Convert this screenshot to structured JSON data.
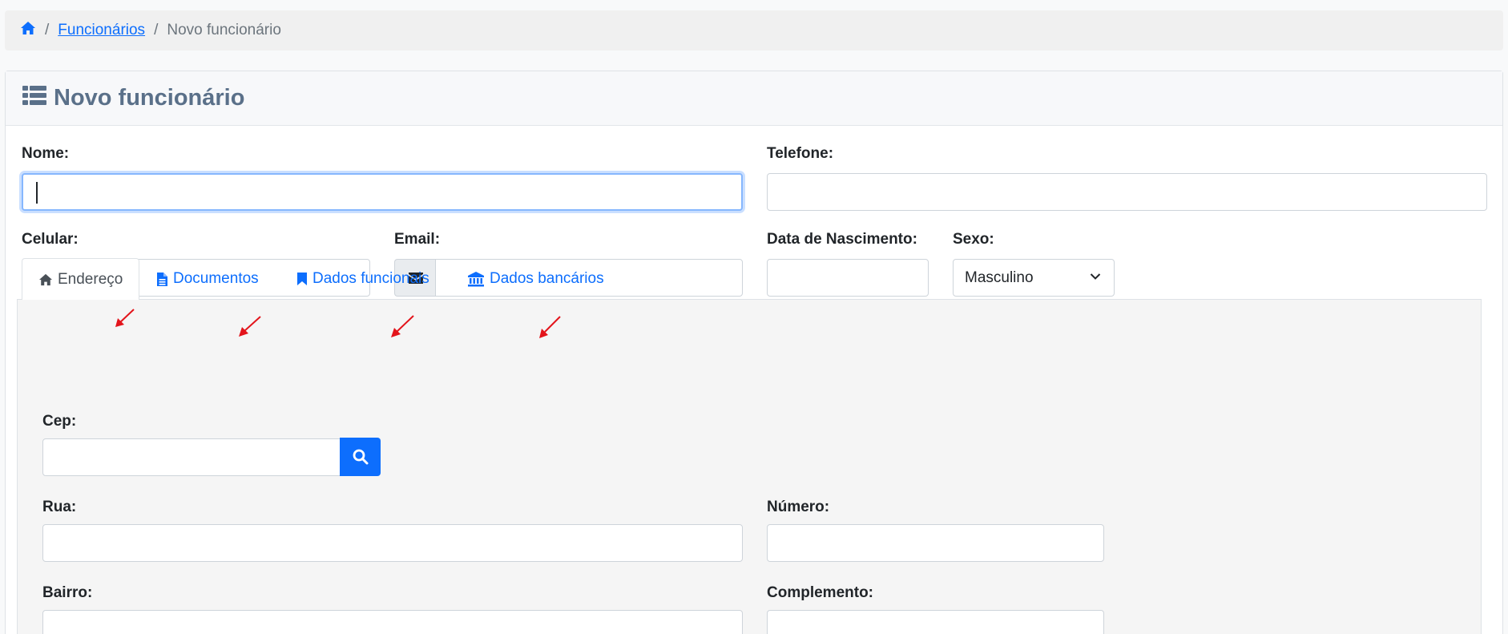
{
  "breadcrumb": {
    "home_icon": "home-icon",
    "link_label": "Funcionários",
    "current": "Novo funcionário",
    "separator": "/"
  },
  "card": {
    "title": "Novo funcionário",
    "title_icon": "list-icon"
  },
  "fields": {
    "nome": {
      "label": "Nome:",
      "value": ""
    },
    "telefone": {
      "label": "Telefone:",
      "value": ""
    },
    "celular": {
      "label": "Celular:",
      "value": ""
    },
    "email": {
      "label": "Email:",
      "value": "",
      "icon": "envelope-icon"
    },
    "data_nascimento": {
      "label": "Data de Nascimento:",
      "value": ""
    },
    "sexo": {
      "label": "Sexo:",
      "selected": "Masculino"
    }
  },
  "tabs": [
    {
      "label": "Endereço",
      "icon": "home-icon",
      "active": true
    },
    {
      "label": "Documentos",
      "icon": "file-icon",
      "active": false
    },
    {
      "label": "Dados funcionais",
      "icon": "bookmark-icon",
      "active": false
    },
    {
      "label": "Dados bancários",
      "icon": "bank-icon",
      "active": false
    }
  ],
  "address": {
    "cep": {
      "label": "Cep:",
      "value": "",
      "button_icon": "search-icon"
    },
    "rua": {
      "label": "Rua:",
      "value": ""
    },
    "numero": {
      "label": "Número:",
      "value": ""
    },
    "bairro": {
      "label": "Bairro:",
      "value": ""
    },
    "complemento": {
      "label": "Complemento:",
      "value": ""
    }
  },
  "colors": {
    "primary": "#0d6efd",
    "title": "#5a7089",
    "annotation_arrow": "#e3141b"
  }
}
